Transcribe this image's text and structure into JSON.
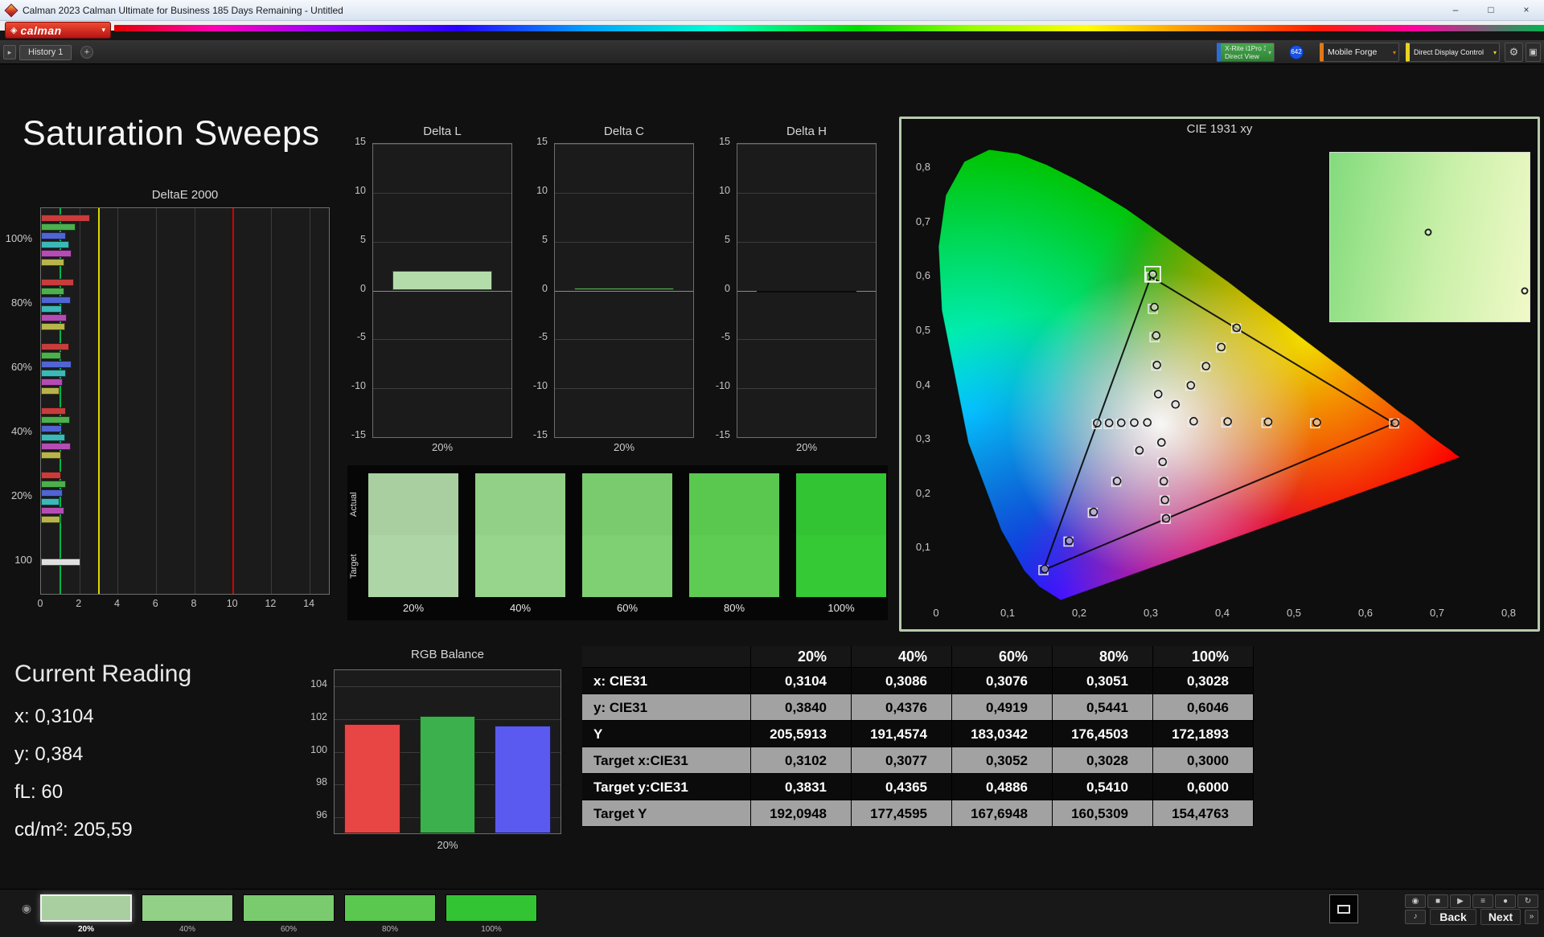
{
  "window": {
    "title": "Calman 2023 Calman Ultimate for Business 185 Days Remaining  - Untitled",
    "minimize": "–",
    "maximize": "□",
    "close": "×"
  },
  "brand": {
    "logo": "calman",
    "diamond": "◈",
    "caret": "▾"
  },
  "toolbar": {
    "panel_toggle": "▸",
    "history_tab": "History 1",
    "add_tab": "+",
    "caret": "▾",
    "meter1_line1": "X-Rite i1Pro 3",
    "meter1_line2": "Direct View",
    "meter1_badge": "642",
    "meter2": "Mobile Forge",
    "meter3": "Direct Display Control",
    "gear": "⚙",
    "monitor": "▣"
  },
  "page": {
    "title": "Saturation Sweeps"
  },
  "current_reading": {
    "heading": "Current Reading",
    "line_x": "x: 0,3104",
    "line_y": "y: 0,384",
    "line_fl": "fL: 60",
    "line_cd": "cd/m²: 205,59"
  },
  "patch_panel": {
    "actual_label": "Actual",
    "target_label": "Target",
    "patches": [
      {
        "label": "20%",
        "actual": "#a9cfa0",
        "target": "#aed5a5"
      },
      {
        "label": "40%",
        "actual": "#92cf87",
        "target": "#97d48c"
      },
      {
        "label": "60%",
        "actual": "#7acb6e",
        "target": "#7ed072"
      },
      {
        "label": "80%",
        "actual": "#5ac74f",
        "target": "#5ecc52"
      },
      {
        "label": "100%",
        "actual": "#33c433",
        "target": "#35c935"
      }
    ]
  },
  "table": {
    "columns": [
      "20%",
      "40%",
      "60%",
      "80%",
      "100%"
    ],
    "rows": [
      {
        "label": "x: CIE31",
        "values": [
          "0,3104",
          "0,3086",
          "0,3076",
          "0,3051",
          "0,3028"
        ]
      },
      {
        "label": "y: CIE31",
        "values": [
          "0,3840",
          "0,4376",
          "0,4919",
          "0,5441",
          "0,6046"
        ]
      },
      {
        "label": "Y",
        "values": [
          "205,5913",
          "191,4574",
          "183,0342",
          "176,4503",
          "172,1893"
        ]
      },
      {
        "label": "Target x:CIE31",
        "values": [
          "0,3102",
          "0,3077",
          "0,3052",
          "0,3028",
          "0,3000"
        ]
      },
      {
        "label": "Target y:CIE31",
        "values": [
          "0,3831",
          "0,4365",
          "0,4886",
          "0,5410",
          "0,6000"
        ]
      },
      {
        "label": "Target Y",
        "values": [
          "192,0948",
          "177,4595",
          "167,6948",
          "160,5309",
          "154,4763"
        ]
      }
    ]
  },
  "bottom_bar": {
    "eye": "◉",
    "patches": [
      {
        "label": "20%",
        "color": "#a9cfa0",
        "selected": true
      },
      {
        "label": "40%",
        "color": "#92cf87",
        "selected": false
      },
      {
        "label": "60%",
        "color": "#7acb6e",
        "selected": false
      },
      {
        "label": "80%",
        "color": "#5ac74f",
        "selected": false
      },
      {
        "label": "100%",
        "color": "#33c433",
        "selected": false
      }
    ],
    "transport": [
      "◉",
      "■",
      "▶",
      "≡",
      "●",
      "↻"
    ],
    "speaker": "♪",
    "back": "Back",
    "next": "Next",
    "next_more": "»"
  },
  "chart_data": [
    {
      "name": "deltae2000",
      "type": "bar",
      "orientation": "horizontal",
      "title": "DeltaE 2000",
      "xlim": [
        0,
        15
      ],
      "xticks": [
        0,
        2,
        4,
        6,
        8,
        10,
        12,
        14
      ],
      "reference_lines": [
        {
          "value": 1,
          "color": "#00b44c"
        },
        {
          "value": 3,
          "color": "#d8d800"
        },
        {
          "value": 10,
          "color": "#d80000"
        }
      ],
      "series_colors": {
        "red": "#c83c3c",
        "green": "#4cb04c",
        "blue": "#5064d2",
        "cyan": "#3cb8b8",
        "magenta": "#b44cb4",
        "yellow": "#b8b44c",
        "white": "#e0e0e0"
      },
      "groups": [
        {
          "label": "100%",
          "bars": [
            {
              "color": "red",
              "value": 2.55
            },
            {
              "color": "green",
              "value": 1.8
            },
            {
              "color": "blue",
              "value": 1.3
            },
            {
              "color": "cyan",
              "value": 1.45
            },
            {
              "color": "magenta",
              "value": 1.6
            },
            {
              "color": "yellow",
              "value": 1.2
            }
          ]
        },
        {
          "label": "80%",
          "bars": [
            {
              "color": "red",
              "value": 1.7
            },
            {
              "color": "green",
              "value": 1.2
            },
            {
              "color": "blue",
              "value": 1.55
            },
            {
              "color": "cyan",
              "value": 1.1
            },
            {
              "color": "magenta",
              "value": 1.35
            },
            {
              "color": "yellow",
              "value": 1.25
            }
          ]
        },
        {
          "label": "60%",
          "bars": [
            {
              "color": "red",
              "value": 1.45
            },
            {
              "color": "green",
              "value": 1.05
            },
            {
              "color": "blue",
              "value": 1.6
            },
            {
              "color": "cyan",
              "value": 1.3
            },
            {
              "color": "magenta",
              "value": 1.15
            },
            {
              "color": "yellow",
              "value": 0.95
            }
          ]
        },
        {
          "label": "40%",
          "bars": [
            {
              "color": "red",
              "value": 1.3
            },
            {
              "color": "green",
              "value": 1.5
            },
            {
              "color": "blue",
              "value": 1.1
            },
            {
              "color": "cyan",
              "value": 1.25
            },
            {
              "color": "magenta",
              "value": 1.55
            },
            {
              "color": "yellow",
              "value": 1.05
            }
          ]
        },
        {
          "label": "20%",
          "bars": [
            {
              "color": "red",
              "value": 1.05
            },
            {
              "color": "green",
              "value": 1.3
            },
            {
              "color": "blue",
              "value": 1.15
            },
            {
              "color": "cyan",
              "value": 0.95
            },
            {
              "color": "magenta",
              "value": 1.2
            },
            {
              "color": "yellow",
              "value": 1.0
            }
          ]
        },
        {
          "label": "100",
          "bars": [
            {
              "color": "white",
              "value": 2.05
            }
          ]
        }
      ]
    },
    {
      "name": "delta-l",
      "type": "bar",
      "title": "Delta L",
      "ylim": [
        -15,
        15
      ],
      "yticks": [
        15,
        10,
        5,
        0,
        -5,
        -10,
        -15
      ],
      "categories": [
        "20%"
      ],
      "values": [
        2.0
      ],
      "bar_color": "#b4dcaa"
    },
    {
      "name": "delta-c",
      "type": "bar",
      "title": "Delta C",
      "ylim": [
        -15,
        15
      ],
      "yticks": [
        15,
        10,
        5,
        0,
        -5,
        -10,
        -15
      ],
      "categories": [
        "20%"
      ],
      "values": [
        0.25
      ],
      "bar_color": "#58a858"
    },
    {
      "name": "delta-h",
      "type": "bar",
      "title": "Delta H",
      "ylim": [
        -15,
        15
      ],
      "yticks": [
        15,
        10,
        5,
        0,
        -5,
        -10,
        -15
      ],
      "categories": [
        "20%"
      ],
      "values": [
        -0.15
      ],
      "bar_color": "#222222"
    },
    {
      "name": "rgb-balance",
      "type": "bar",
      "title": "RGB Balance",
      "ylim": [
        95,
        105
      ],
      "yticks": [
        104,
        102,
        100,
        98,
        96
      ],
      "categories": [
        "R",
        "G",
        "B"
      ],
      "values": [
        101.7,
        102.2,
        101.6
      ],
      "colors": [
        "#e84545",
        "#3cb04c",
        "#5a5af0"
      ],
      "xlabel": "20%"
    },
    {
      "name": "cie1931",
      "type": "scatter",
      "title": "CIE 1931 xy",
      "xlim": [
        0,
        0.8369
      ],
      "ylim": [
        0,
        0.8359
      ],
      "xtick_values": [
        0,
        0.1,
        0.2,
        0.3,
        0.4,
        0.5,
        0.6,
        0.7,
        0.8
      ],
      "xtick_labels": [
        "0",
        "0,1",
        "0,2",
        "0,3",
        "0,4",
        "0,5",
        "0,6",
        "0,7",
        "0,8"
      ],
      "ytick_values": [
        0.1,
        0.2,
        0.3,
        0.4,
        0.5,
        0.6,
        0.7,
        0.8
      ],
      "ytick_labels": [
        "0,1",
        "0,2",
        "0,3",
        "0,4",
        "0,5",
        "0,6",
        "0,7",
        "0,8"
      ],
      "white_point": [
        0.3127,
        0.329
      ],
      "gamut": {
        "red": [
          0.64,
          0.33
        ],
        "green": [
          0.3,
          0.6
        ],
        "blue": [
          0.15,
          0.06
        ]
      },
      "sweeps": [
        {
          "name": "red",
          "targets": [
            [
              0.3585,
              0.3324
            ],
            [
              0.4056,
              0.3318
            ],
            [
              0.4617,
              0.3311
            ],
            [
              0.5296,
              0.3303
            ],
            [
              0.64,
              0.33
            ]
          ],
          "measured": [
            [
              0.36,
              0.334
            ],
            [
              0.4075,
              0.3335
            ],
            [
              0.464,
              0.333
            ],
            [
              0.532,
              0.332
            ],
            [
              0.6415,
              0.331
            ]
          ]
        },
        {
          "name": "green",
          "targets": [
            [
              0.3102,
              0.3831
            ],
            [
              0.3077,
              0.4365
            ],
            [
              0.3052,
              0.4886
            ],
            [
              0.3028,
              0.541
            ],
            [
              0.3,
              0.6
            ]
          ],
          "measured": [
            [
              0.3104,
              0.384
            ],
            [
              0.3086,
              0.4376
            ],
            [
              0.3076,
              0.4919
            ],
            [
              0.3051,
              0.5441
            ],
            [
              0.3028,
              0.6046
            ]
          ]
        },
        {
          "name": "blue",
          "targets": [
            [
              0.2833,
              0.2793
            ],
            [
              0.2518,
              0.2226
            ],
            [
              0.2189,
              0.1656
            ],
            [
              0.185,
              0.1125
            ],
            [
              0.15,
              0.06
            ]
          ],
          "measured": [
            [
              0.2842,
              0.2805
            ],
            [
              0.253,
              0.224
            ],
            [
              0.2202,
              0.167
            ],
            [
              0.1862,
              0.114
            ],
            [
              0.1518,
              0.0622
            ]
          ]
        },
        {
          "name": "cyan",
          "targets": [
            [
              0.2946,
              0.3302
            ],
            [
              0.2764,
              0.3297
            ],
            [
              0.258,
              0.3292
            ],
            [
              0.241,
              0.3288
            ],
            [
              0.2246,
              0.3287
            ]
          ],
          "measured": [
            [
              0.2952,
              0.3318
            ],
            [
              0.277,
              0.3315
            ],
            [
              0.2588,
              0.3312
            ],
            [
              0.2418,
              0.331
            ],
            [
              0.2252,
              0.3308
            ]
          ]
        },
        {
          "name": "magenta",
          "targets": [
            [
              0.3143,
              0.2938
            ],
            [
              0.316,
              0.2582
            ],
            [
              0.3177,
              0.2226
            ],
            [
              0.3193,
              0.1884
            ],
            [
              0.3209,
              0.1542
            ]
          ],
          "measured": [
            [
              0.315,
              0.295
            ],
            [
              0.3166,
              0.2592
            ],
            [
              0.3182,
              0.2236
            ],
            [
              0.3198,
              0.1892
            ],
            [
              0.3214,
              0.1552
            ]
          ]
        },
        {
          "name": "yellow",
          "targets": [
            [
              0.334,
              0.3641
            ],
            [
              0.3553,
              0.3993
            ],
            [
              0.3766,
              0.4346
            ],
            [
              0.398,
              0.4699
            ],
            [
              0.4193,
              0.5053
            ]
          ],
          "measured": [
            [
              0.3346,
              0.365
            ],
            [
              0.356,
              0.4001
            ],
            [
              0.3772,
              0.4354
            ],
            [
              0.3986,
              0.4706
            ],
            [
              0.42,
              0.506
            ]
          ]
        }
      ],
      "current": [
        0.3028,
        0.6046
      ],
      "inset": {
        "colors": [
          "#82db7c",
          "#c9f0a8",
          "#f0f9c8"
        ],
        "points": [
          [
            0.49,
            0.47
          ],
          [
            0.975,
            0.82
          ]
        ]
      }
    }
  ]
}
